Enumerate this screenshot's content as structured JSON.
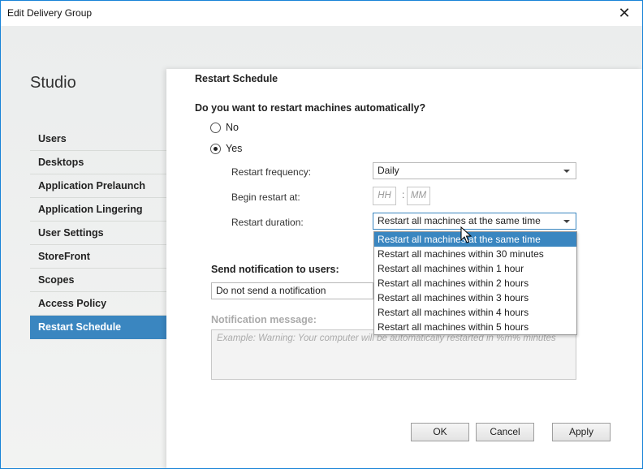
{
  "window": {
    "title": "Edit Delivery Group",
    "close_glyph": "✕"
  },
  "sidebar": {
    "title": "Studio",
    "items": [
      {
        "label": "Users"
      },
      {
        "label": "Desktops"
      },
      {
        "label": "Application Prelaunch"
      },
      {
        "label": "Application Lingering"
      },
      {
        "label": "User Settings"
      },
      {
        "label": "StoreFront"
      },
      {
        "label": "Scopes"
      },
      {
        "label": "Access Policy"
      },
      {
        "label": "Restart Schedule",
        "active": true
      }
    ]
  },
  "main": {
    "heading": "Restart Schedule",
    "question": "Do you want to restart machines automatically?",
    "radio_no": "No",
    "radio_yes": "Yes",
    "selected_radio": "Yes",
    "frequency_label": "Restart frequency:",
    "frequency_value": "Daily",
    "begin_label": "Begin restart at:",
    "hour_placeholder": "HH",
    "minute_placeholder": "MM",
    "time_separator": ":",
    "duration_label": "Restart duration:",
    "duration_value": "Restart all machines at the same time",
    "duration_options": [
      "Restart all machines at the same time",
      "Restart all machines within 30 minutes",
      "Restart all machines within 1 hour",
      "Restart all machines within 2 hours",
      "Restart all machines within 3 hours",
      "Restart all machines within 4 hours",
      "Restart all machines within 5 hours"
    ],
    "highlighted_option": "Restart all machines at the same time",
    "notification_label": "Send notification to users:",
    "notification_value": "Do not send a notification",
    "message_label": "Notification message:",
    "message_placeholder": "Example:  Warning: Your computer will be automatically restarted in %m% minutes"
  },
  "buttons": {
    "ok": "OK",
    "cancel": "Cancel",
    "apply": "Apply"
  },
  "colors": {
    "accent": "#3a86c0",
    "window_border": "#1883d7"
  }
}
